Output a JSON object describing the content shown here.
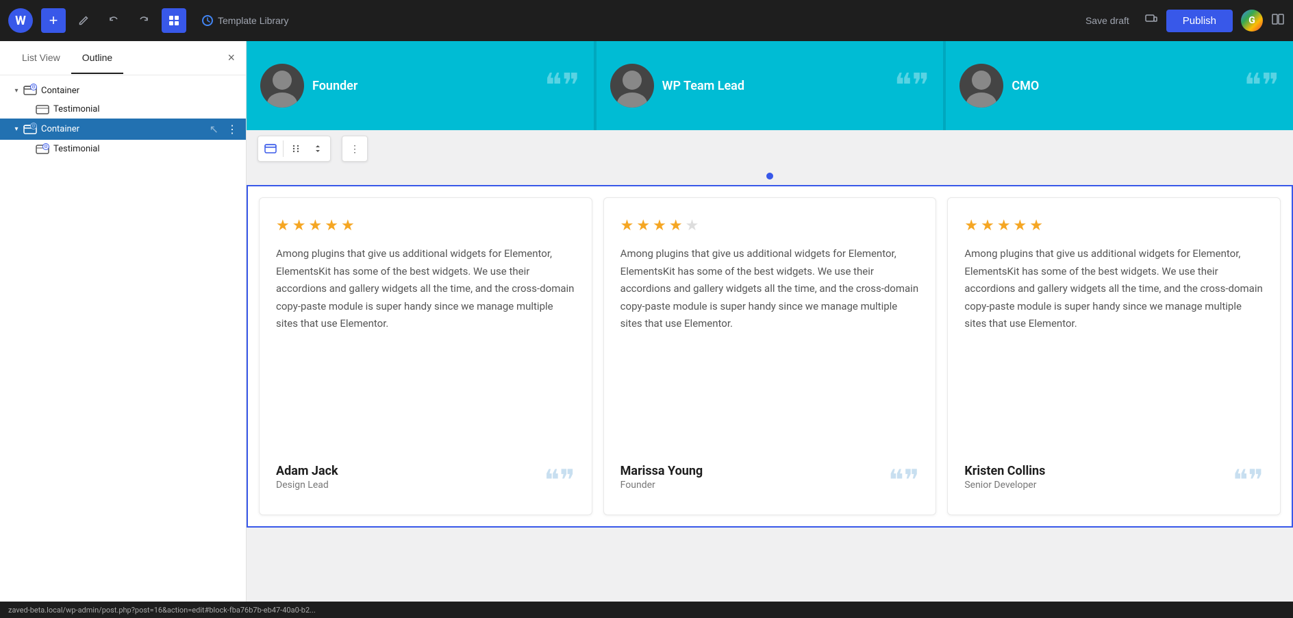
{
  "toolbar": {
    "wp_logo": "W",
    "add_label": "+",
    "pencil_label": "✏",
    "undo_label": "↩",
    "redo_label": "↪",
    "blocks_label": "☰",
    "template_library": "Template Library",
    "save_draft": "Save draft",
    "publish": "Publish",
    "responsive_icon": "⬜",
    "split_view_icon": "⬜⬜"
  },
  "sidebar": {
    "tab_list_view": "List View",
    "tab_outline": "Outline",
    "close_icon": "×",
    "tree": [
      {
        "id": "container-1",
        "label": "Container",
        "indent": 0,
        "has_toggle": true,
        "toggle_open": true,
        "selected": false,
        "has_badge": true
      },
      {
        "id": "testimonial-1",
        "label": "Testimonial",
        "indent": 1,
        "has_toggle": false,
        "selected": false,
        "has_badge": false
      },
      {
        "id": "container-2",
        "label": "Container",
        "indent": 0,
        "has_toggle": true,
        "toggle_open": true,
        "selected": true,
        "has_badge": true
      },
      {
        "id": "testimonial-2",
        "label": "Testimonial",
        "indent": 1,
        "has_toggle": false,
        "selected": false,
        "has_badge": true
      }
    ]
  },
  "top_cards": [
    {
      "avatar": "👤",
      "title": "Founder",
      "quote": "❝❞"
    },
    {
      "avatar": "👤",
      "title": "WP Team Lead",
      "quote": "❝❞"
    },
    {
      "avatar": "👤",
      "title": "CMO",
      "quote": "❝❞"
    }
  ],
  "block_toolbar": {
    "icon_container": "▣",
    "move_icon": "⠿",
    "up_down_icon": "⇅",
    "more_icon": "⋮"
  },
  "dot_indicator": {
    "active_index": 0,
    "total": 1
  },
  "testimonials": [
    {
      "stars": [
        true,
        true,
        true,
        true,
        true
      ],
      "text": "Among plugins that give us additional widgets for Elementor, ElementsKit has some of the best widgets. We use their accordions and gallery widgets all the time, and the cross-domain copy-paste module is super handy since we manage multiple sites that use Elementor.",
      "name": "Adam Jack",
      "role": "Design Lead",
      "quote_icon": "❝❞"
    },
    {
      "stars": [
        true,
        true,
        true,
        true,
        false
      ],
      "text": "Among plugins that give us additional widgets for Elementor, ElementsKit has some of the best widgets. We use their accordions and gallery widgets all the time, and the cross-domain copy-paste module is super handy since we manage multiple sites that use Elementor.",
      "name": "Marissa Young",
      "role": "Founder",
      "quote_icon": "❝❞"
    },
    {
      "stars": [
        true,
        true,
        true,
        true,
        true
      ],
      "text": "Among plugins that give us additional widgets for Elementor, ElementsKit has some of the best widgets. We use their accordions and gallery widgets all the time, and the cross-domain copy-paste module is super handy since we manage multiple sites that use Elementor.",
      "name": "Kristen Collins",
      "role": "Senior Developer",
      "quote_icon": "❝❞"
    }
  ],
  "status_bar": {
    "url": "zaved-beta.local/wp-admin/post.php?post=16&action=edit#block-fba76b7b-eb47-40a0-b2..."
  },
  "colors": {
    "primary_blue": "#3858e9",
    "wp_blue": "#2271b1",
    "cyan": "#00bcd4",
    "star_gold": "#f5a623",
    "selected_bg": "#2271b1"
  }
}
